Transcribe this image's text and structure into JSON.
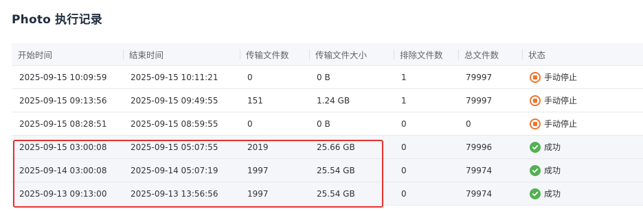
{
  "page": {
    "title": "Photo 执行记录"
  },
  "colors": {
    "stop": "#f0742b",
    "success": "#52b152",
    "highlight_border": "#e8302c"
  },
  "table": {
    "headers": [
      "开始时间",
      "结束时间",
      "传输文件数",
      "传输文件大小",
      "排除文件数",
      "总文件数",
      "状态"
    ],
    "rows": [
      {
        "start": "2025-09-15 10:09:59",
        "end": "2025-09-15 10:11:21",
        "files": "0",
        "size": "0 B",
        "excluded": "1",
        "total": "79997",
        "status": "手动停止",
        "status_icon": "stop-icon"
      },
      {
        "start": "2025-09-15 09:13:56",
        "end": "2025-09-15 09:49:55",
        "files": "151",
        "size": "1.24 GB",
        "excluded": "1",
        "total": "79997",
        "status": "手动停止",
        "status_icon": "stop-icon"
      },
      {
        "start": "2025-09-15 08:28:51",
        "end": "2025-09-15 08:59:55",
        "files": "0",
        "size": "0 B",
        "excluded": "0",
        "total": "0",
        "status": "手动停止",
        "status_icon": "stop-icon"
      },
      {
        "start": "2025-09-15 03:00:08",
        "end": "2025-09-15 05:07:55",
        "files": "2019",
        "size": "25.66 GB",
        "excluded": "0",
        "total": "79996",
        "status": "成功",
        "status_icon": "check-circle-icon"
      },
      {
        "start": "2025-09-14 03:00:08",
        "end": "2025-09-14 05:07:19",
        "files": "1997",
        "size": "25.54 GB",
        "excluded": "0",
        "total": "79974",
        "status": "成功",
        "status_icon": "check-circle-icon"
      },
      {
        "start": "2025-09-13 09:13:00",
        "end": "2025-09-13 13:56:56",
        "files": "1997",
        "size": "25.54 GB",
        "excluded": "0",
        "total": "79974",
        "status": "成功",
        "status_icon": "check-circle-icon"
      }
    ]
  }
}
